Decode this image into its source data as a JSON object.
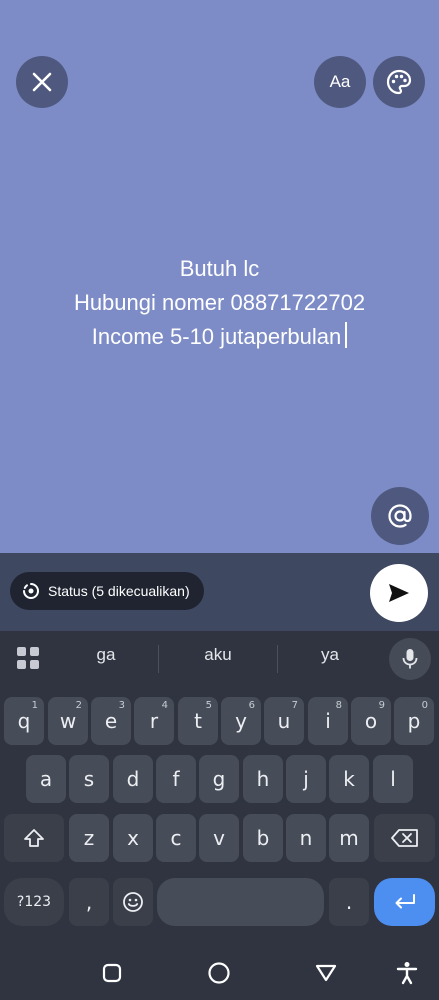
{
  "composer": {
    "background": "#7d8cc6",
    "font_button_label": "Aa",
    "status_lines": [
      "Butuh lc",
      "Hubungi nomer 08871722702",
      "Income 5-10 jutaperbulan"
    ]
  },
  "send_bar": {
    "audience_label": "Status (5 dikecualikan)"
  },
  "keyboard": {
    "suggestions": [
      "ga",
      "aku",
      "ya"
    ],
    "row1": [
      {
        "k": "q",
        "h": "1"
      },
      {
        "k": "w",
        "h": "2"
      },
      {
        "k": "e",
        "h": "3"
      },
      {
        "k": "r",
        "h": "4"
      },
      {
        "k": "t",
        "h": "5"
      },
      {
        "k": "y",
        "h": "6"
      },
      {
        "k": "u",
        "h": "7"
      },
      {
        "k": "i",
        "h": "8"
      },
      {
        "k": "o",
        "h": "9"
      },
      {
        "k": "p",
        "h": "0"
      }
    ],
    "row2": [
      "a",
      "s",
      "d",
      "f",
      "g",
      "h",
      "j",
      "k",
      "l"
    ],
    "row3": [
      "z",
      "x",
      "c",
      "v",
      "b",
      "n",
      "m"
    ],
    "symbols_label": "?123",
    "comma_label": ",",
    "period_label": ".",
    "enter_color": "#4d8ff0"
  }
}
